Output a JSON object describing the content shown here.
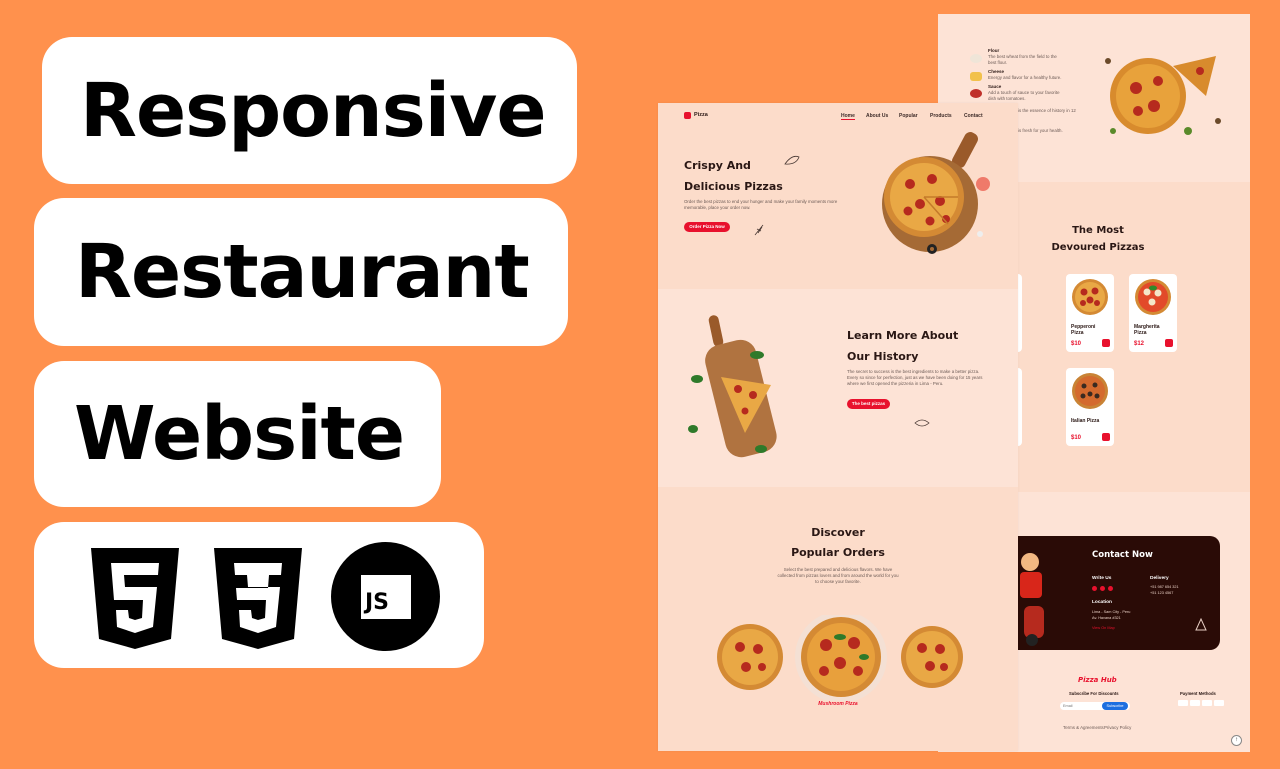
{
  "banner": {
    "line1": "Responsive",
    "line2": "Restaurant",
    "line3": "Website",
    "tech_icons": [
      "html5-icon",
      "css3-icon",
      "javascript-icon"
    ],
    "js_label": "JS"
  },
  "colors": {
    "background": "#ff914d",
    "accent": "#e8112d",
    "page": "#fcdcca",
    "dark": "#2a0b06"
  },
  "front": {
    "brand": "Pizza",
    "nav": [
      "Home",
      "About Us",
      "Popular",
      "Products",
      "Contact"
    ],
    "hero": {
      "title1": "Crispy And",
      "title2": "Delicious Pizzas",
      "text": "Order the best pizzas to end your hunger and make your family moments more memorable, place your order now.",
      "button": "Order Pizza Now"
    },
    "about": {
      "title1": "Learn More About",
      "title2": "Our History",
      "text": "The secret to success is the best ingredients to make a better pizza. Every so since for perfection, just as we have been doing for 15 years where we first opened the pizzeria in Lima - Peru.",
      "button": "The best pizzas"
    },
    "popular": {
      "title1": "Discover",
      "title2": "Popular Orders",
      "text": "Select the best prepared and delicious flavors. We have collected from pizzas lovers and from around the world for you to choose your favorite.",
      "featured": "Mushroom Pizza"
    }
  },
  "back": {
    "ingredients": [
      {
        "name": "Flour",
        "desc": "The best wheat from the field to the best flour."
      },
      {
        "name": "Cheese",
        "desc": "Energy and flavor for a healthy future."
      },
      {
        "name": "Sauce",
        "desc": "Add a touch of sauce to your favorite dish with tomatoes."
      }
    ],
    "about_note1": "is the essence of history in 12",
    "about_note2": "is fresh for your health.",
    "products_title1": "The Most",
    "products_title2": "Devoured Pizzas",
    "products": [
      {
        "name": "ian",
        "price": ""
      },
      {
        "name": "Pepperoni Pizza",
        "price": "$10"
      },
      {
        "name": "Margherita Pizza",
        "price": "$12"
      },
      {
        "name": "on",
        "price": ""
      },
      {
        "name": "Italian Pizza",
        "price": "$10"
      }
    ],
    "contact": {
      "title": "Contact Now",
      "write_us": "Write Us",
      "delivery": "Delivery",
      "delivery_line1": "+51 987 654 321",
      "delivery_line2": "+51 123 4567",
      "location": "Location",
      "location_line1": "Lima - Sam City - Peru",
      "location_line2": "Av. Havana #321",
      "view_map": "View On Map"
    },
    "footer": {
      "brand": "Pizza Hub",
      "subscribe": "Subscribe For Discounts",
      "email_placeholder": "Email",
      "subscribe_button": "Subscribe",
      "payment": "Payment Methods",
      "links": [
        "Terms & Agreements",
        "Privacy Policy"
      ]
    }
  }
}
